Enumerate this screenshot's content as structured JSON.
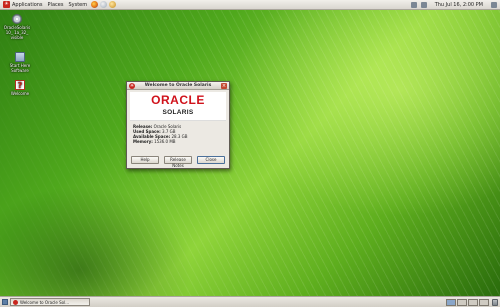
{
  "top_panel": {
    "menus": [
      "Applications",
      "Places",
      "System"
    ],
    "clock": "Thu Jul 16,  2:00 PM"
  },
  "desktop_icons": [
    {
      "label": "OracleSolaris 10_ 1a_32_ visible",
      "icon": "disc-icon"
    },
    {
      "label": "Start Here Software",
      "icon": "folder-icon"
    },
    {
      "label": "Welcome",
      "icon": "help-icon"
    }
  ],
  "dialog": {
    "title": "Welcome to Oracle Solaris",
    "brand": "ORACLE",
    "product": "SOLARIS",
    "info": [
      {
        "key": "Release:",
        "value": "Oracle Solaris"
      },
      {
        "key": "Used Space:",
        "value": "3.7 GB"
      },
      {
        "key": "Available Space:",
        "value": "28.3 GB"
      },
      {
        "key": "Memory:",
        "value": "1536.0 MB"
      }
    ],
    "buttons": [
      "Help",
      "Release Notes",
      "Close"
    ]
  },
  "taskbar": {
    "task_label": "Welcome to Oracle Sol..."
  },
  "colors": {
    "oracle_red": "#d0121b",
    "panel": "#e3e0d9"
  }
}
